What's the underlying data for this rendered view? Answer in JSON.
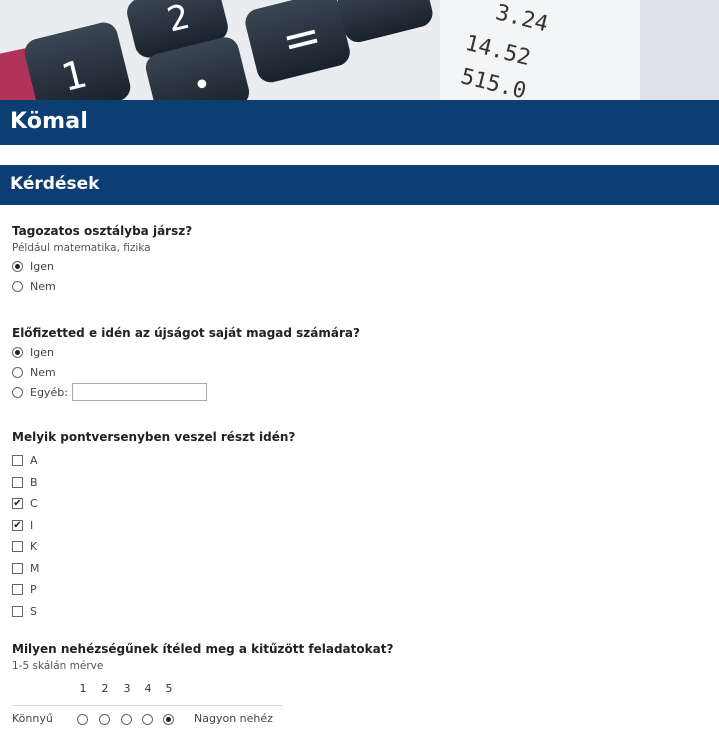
{
  "site": {
    "title": "Kömal"
  },
  "section": {
    "title": "Kérdések"
  },
  "questions": [
    {
      "title": "Tagozatos osztályba jársz?",
      "help": "Például matematika, fizika",
      "type": "radio",
      "options": [
        {
          "label": "Igen",
          "selected": true
        },
        {
          "label": "Nem",
          "selected": false
        }
      ]
    },
    {
      "title": "Előfizetted e idén az újságot saját magad számára?",
      "type": "radio",
      "options": [
        {
          "label": "Igen",
          "selected": true
        },
        {
          "label": "Nem",
          "selected": false
        },
        {
          "label": "Egyéb:",
          "selected": false,
          "other_value": ""
        }
      ]
    },
    {
      "title": "Melyik pontversenyben veszel részt idén?",
      "type": "checkbox",
      "options": [
        {
          "label": "A",
          "checked": false
        },
        {
          "label": "B",
          "checked": false
        },
        {
          "label": "C",
          "checked": true
        },
        {
          "label": "I",
          "checked": true
        },
        {
          "label": "K",
          "checked": false
        },
        {
          "label": "M",
          "checked": false
        },
        {
          "label": "P",
          "checked": false
        },
        {
          "label": "S",
          "checked": false
        }
      ]
    },
    {
      "title": "Milyen nehézségűnek ítéled meg a kitűzött feladatokat?",
      "help": "1-5 skálán mérve",
      "type": "scale",
      "scale_numbers": [
        "1",
        "2",
        "3",
        "4",
        "5"
      ],
      "low_label": "Könnyű",
      "high_label": "Nagyon nehéz",
      "selected": "5"
    }
  ],
  "banner_digits": {
    "d1": "1",
    "d2": "2",
    "eq": "=",
    "dot": "•",
    "r1": "3.24",
    "r2": "14.52",
    "r3": "515.0"
  }
}
